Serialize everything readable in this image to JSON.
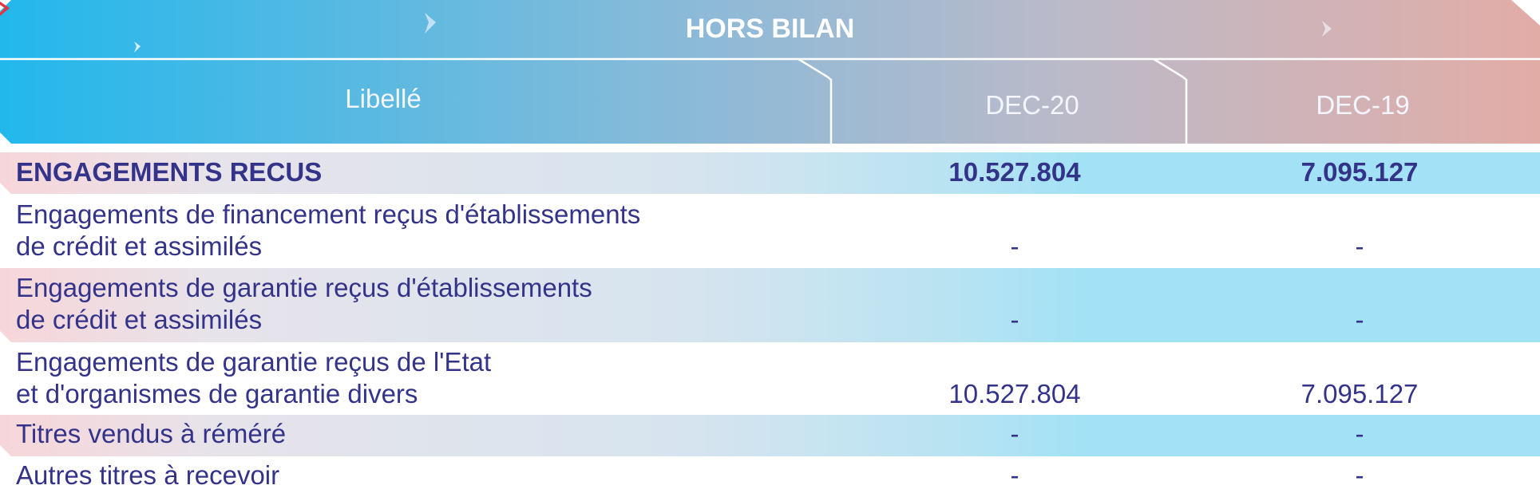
{
  "header": {
    "title": "HORS BILAN",
    "columns": [
      "Libellé",
      "DEC-20",
      "DEC-19"
    ]
  },
  "rows": [
    {
      "label_lines": [
        "ENGAGEMENTS RECUS"
      ],
      "dec20": "10.527.804",
      "dec19": "7.095.127",
      "bold": true
    },
    {
      "label_lines": [
        "Engagements de financement reçus d'établissements",
        "de crédit et assimilés"
      ],
      "dec20": "-",
      "dec19": "-"
    },
    {
      "label_lines": [
        "Engagements de garantie reçus d'établissements",
        "de crédit et assimilés"
      ],
      "dec20": "-",
      "dec19": "-"
    },
    {
      "label_lines": [
        "Engagements de garantie reçus de l'Etat",
        "et d'organismes de garantie divers"
      ],
      "dec20": "10.527.804",
      "dec19": "7.095.127"
    },
    {
      "label_lines": [
        "Titres vendus à réméré"
      ],
      "dec20": "-",
      "dec19": "-"
    },
    {
      "label_lines": [
        "Autres titres à recevoir"
      ],
      "dec20": "-",
      "dec19": "-"
    }
  ],
  "colors": {
    "header_start": "#22b8ec",
    "header_end": "#e2aca6",
    "text": "#34338a",
    "row_shade_start": "#f7d6d9",
    "row_shade_end": "#a3e2f6"
  }
}
